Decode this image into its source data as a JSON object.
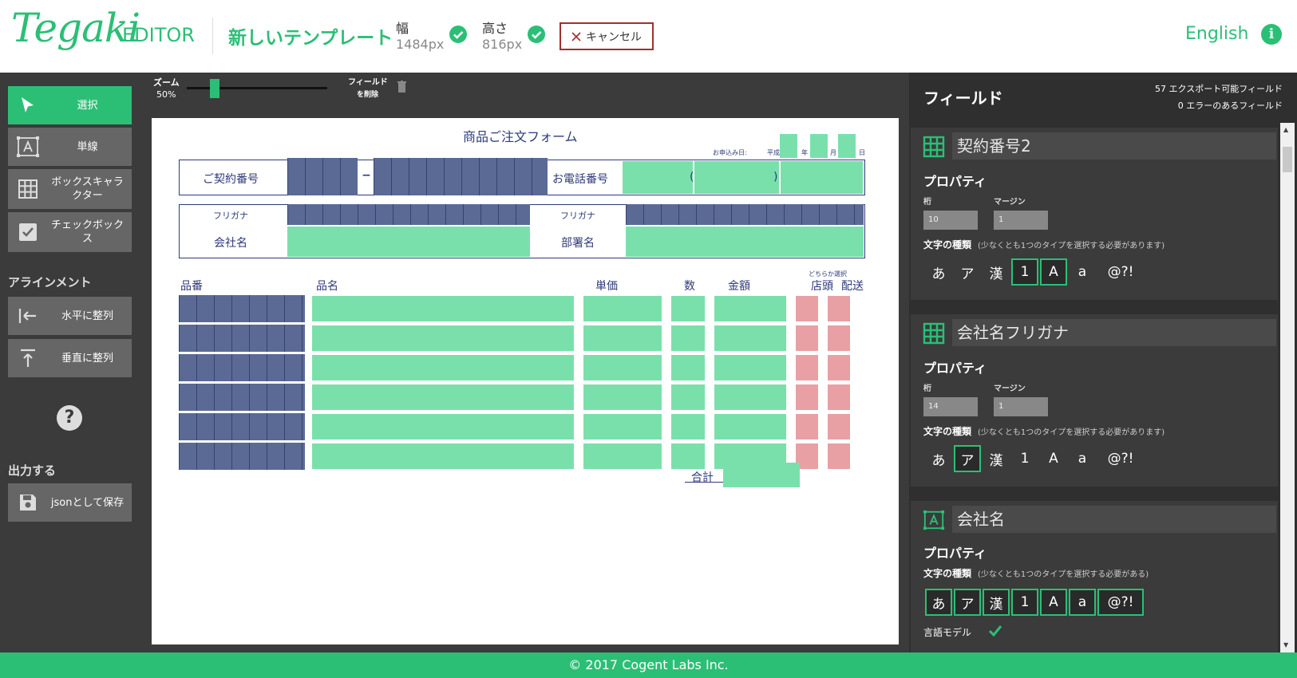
{
  "header": {
    "logo": "Tegaki",
    "editor_label": "EDITOR",
    "template_name": "新しいテンプレート",
    "width_label": "幅",
    "width_value": "1484px",
    "height_label": "高さ",
    "height_value": "816px",
    "cancel_label": "キャンセル",
    "language_label": "English",
    "info_icon": "i"
  },
  "toolbar": {
    "select": "選択",
    "single_line": "単線",
    "box_character": "ボックスキャラクター",
    "checkbox": "チェックボックス",
    "alignment_heading": "アラインメント",
    "align_horizontal": "水平に整列",
    "align_vertical": "垂直に整列",
    "help_icon": "?",
    "output_heading": "出力する",
    "save_json": "jsonとして保存"
  },
  "canvas_bar": {
    "zoom_label": "ズーム",
    "zoom_value": "50%",
    "zoom_fraction": 0.2,
    "delete_field_line1": "フィールド",
    "delete_field_line2": "を削除"
  },
  "form": {
    "title": "商品ご注文フォーム",
    "application_date": "お申込み日:",
    "era": "平成",
    "year": "年",
    "month": "月",
    "day": "日",
    "contract_number": "ご契約番号",
    "dash": "−",
    "phone_number": "お電話番号",
    "paren_open": "(",
    "paren_close": ")",
    "furigana_left": "フリガナ",
    "furigana_right": "フリガナ",
    "company_name": "会社名",
    "department_name": "部署名",
    "choose_one": "どちらか選択",
    "columns": {
      "product_number": "品番",
      "product_name": "品名",
      "unit_price": "単価",
      "quantity": "数",
      "amount": "金額",
      "store": "店頭",
      "delivery": "配送"
    },
    "total": "合計"
  },
  "panel": {
    "title": "フィールド",
    "exportable": "57 エクスポート可能フィールド",
    "errors": "0 エラーのあるフィールド",
    "fields": [
      {
        "name": "契約番号2",
        "icon": "grid-icon",
        "properties_label": "プロパティ",
        "digits_label": "桁",
        "digits_value": "10",
        "margin_label": "マージン",
        "margin_value": "1",
        "char_type_label": "文字の種類",
        "char_type_note": "(少なくとも1つのタイプを選択する必要があります)",
        "types": [
          "あ",
          "ア",
          "漢",
          "1",
          "A",
          "a",
          "@?!"
        ],
        "selected_types": [
          "1",
          "A"
        ]
      },
      {
        "name": "会社名フリガナ",
        "icon": "grid-icon",
        "properties_label": "プロパティ",
        "digits_label": "桁",
        "digits_value": "14",
        "margin_label": "マージン",
        "margin_value": "1",
        "char_type_label": "文字の種類",
        "char_type_note": "(少なくとも1つのタイプを選択する必要があります)",
        "types": [
          "あ",
          "ア",
          "漢",
          "1",
          "A",
          "a",
          "@?!"
        ],
        "selected_types": [
          "ア"
        ]
      },
      {
        "name": "会社名",
        "icon": "text-box-icon",
        "properties_label": "プロパティ",
        "char_type_label": "文字の種類",
        "char_type_note": "(少なくとも1つのタイプを選択する必要がある)",
        "types": [
          "あ",
          "ア",
          "漢",
          "1",
          "A",
          "a",
          "@?!"
        ],
        "selected_types": [
          "あ",
          "ア",
          "漢",
          "1",
          "A",
          "a",
          "@?!"
        ],
        "language_model_label": "言語モデル",
        "language_model_checked": true
      }
    ]
  },
  "footer": {
    "copyright": "© 2017 Cogent Labs Inc."
  },
  "colors": {
    "accent": "#2bbf76",
    "dark_bg": "#3b3b3b",
    "field_navy": "#5b6a95",
    "field_green": "#7ae0ab",
    "field_pink": "#e8a0a5",
    "cancel_border": "#a0302c"
  }
}
